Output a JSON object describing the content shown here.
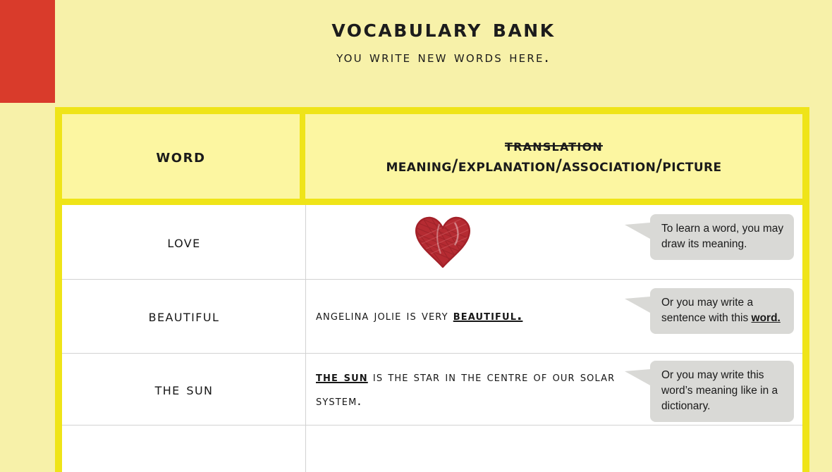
{
  "slide": {
    "title": "Vocabulary Bank",
    "subtitle": "You write new words here."
  },
  "colors": {
    "page_background": "#f7f1a9",
    "accent_red": "#d93b2b",
    "frame_yellow": "#efe418",
    "header_cell_yellow": "#fcf6a1",
    "callout_gray": "#d9d9d6",
    "heart_red": "#b52b32"
  },
  "table": {
    "headers": {
      "word": "Word",
      "meaning_struck": "Translation",
      "meaning": "Meaning/Explanation/Association/Picture"
    },
    "rows": [
      {
        "word": "Love",
        "meaning_type": "drawing",
        "meaning_icon": "hand-drawn-heart-icon",
        "meaning_text": "",
        "callout": {
          "text": "To learn a word, you may draw its meaning.",
          "lines": [
            "To learn a word, you",
            "may draw its meaning."
          ]
        }
      },
      {
        "word": "Beautiful",
        "meaning_type": "sentence",
        "meaning_prefix": "Angelina Jolie is very ",
        "meaning_keyword": "beautiful.",
        "meaning_suffix": "",
        "callout": {
          "text": "Or you may write a sentence with this word.",
          "lines": [
            "Or you may write a",
            "sentence with this",
            "word."
          ],
          "emphasis": "word."
        }
      },
      {
        "word": "The Sun",
        "meaning_type": "definition",
        "meaning_keyword": "The Sun",
        "meaning_rest": " is the star in the centre of our solar system.",
        "callout": {
          "text": "Or you may write this word’s meaning like in a dictionary.",
          "lines": [
            "Or you may write this",
            "word’s meaning like in",
            "a dictionary."
          ]
        }
      },
      {
        "word": "",
        "meaning_type": "empty",
        "meaning_text": ""
      }
    ]
  }
}
